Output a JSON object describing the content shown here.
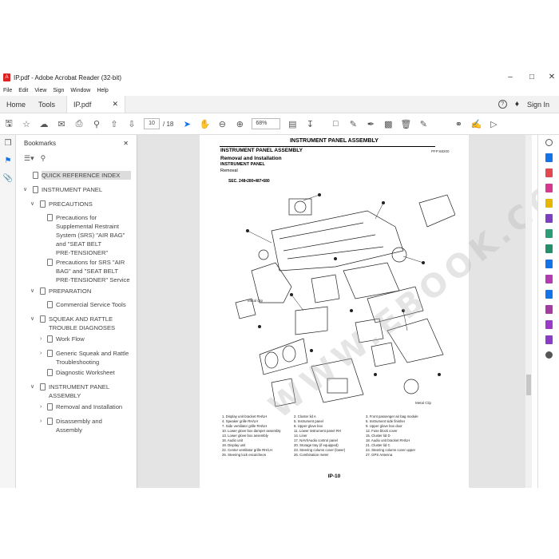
{
  "window": {
    "title": "IP.pdf - Adobe Acrobat Reader (32-bit)"
  },
  "menu": [
    "File",
    "Edit",
    "View",
    "Sign",
    "Window",
    "Help"
  ],
  "tabs": {
    "home": "Home",
    "tools": "Tools",
    "doc": "IP.pdf",
    "signin": "Sign In"
  },
  "toolbar": {
    "page_current": "10",
    "page_total": "/ 18",
    "zoom": "68%"
  },
  "bookmarks": {
    "title": "Bookmarks",
    "items": [
      "QUICK REFERENCE INDEX",
      "INSTRUMENT PANEL",
      "PRECAUTIONS",
      "Precautions for",
      "Supplemental Restraint",
      "System (SRS) \"AIR BAG\"",
      "and \"SEAT BELT",
      "PRE-TENSIONER\"",
      "Precautions for SRS \"AIR",
      "BAG\" and \"SEAT BELT",
      "PRE-TENSIONER\" Service",
      "PREPARATION",
      "Commercial Service Tools",
      "SQUEAK AND RATTLE",
      "TROUBLE DIAGNOSES",
      "Work Flow",
      "Generic Squeak and Rattle",
      "Troubleshooting",
      "Diagnostic Worksheet",
      "INSTRUMENT PANEL",
      "ASSEMBLY",
      "Removal and Installation",
      "Disassembly and",
      "Assembly"
    ]
  },
  "page": {
    "header": "INSTRUMENT PANEL ASSEMBLY",
    "section": "INSTRUMENT PANEL ASSEMBLY",
    "code": "PFP:68200",
    "sub1": "Removal and Installation",
    "sub2": "INSTRUMENT PANEL",
    "sub3": "Removal",
    "sec": "SEC. 248•280•487•680",
    "metal_clip": "Metal clip",
    "metal_clip2": "Metal Clip",
    "page_number": "IP-10",
    "watermark": "WWW.EBOOK.COM",
    "legend": [
      [
        "1.",
        "Display unit bracket RH/LH",
        "2.",
        "Cluster lid A",
        "3.",
        "Front passenger air bag module"
      ],
      [
        "4.",
        "Speaker grille RH/LH",
        "5.",
        "Instrument panel",
        "6.",
        "Instrument side finisher"
      ],
      [
        "7.",
        "Side ventilator grille RH/LH",
        "8.",
        "Upper glove box",
        "9.",
        "Upper glove box door"
      ],
      [
        "10.",
        "Lower glove box damper assembly",
        "11.",
        "Lower instrument panel RH",
        "12.",
        "Fuse block cover"
      ],
      [
        "13.",
        "Lower glove box assembly",
        "14.",
        "Liner",
        "15.",
        "Cluster lid D"
      ],
      [
        "16.",
        "Audio unit",
        "17.",
        "NAVI/Audio control panel",
        "18.",
        "Audio unit bracket RH/LH"
      ],
      [
        "19.",
        "Display unit",
        "20.",
        "Storage tray (if equipped)",
        "21.",
        "Cluster lid C"
      ],
      [
        "22.",
        "Center ventilator grille RH/LH",
        "23.",
        "Steering column cover (lower)",
        "24.",
        "Steering column cover upper"
      ],
      [
        "25.",
        "Steering lock escutcheon",
        "26.",
        "Combination meter",
        "27.",
        "GPS Antenna"
      ]
    ]
  }
}
